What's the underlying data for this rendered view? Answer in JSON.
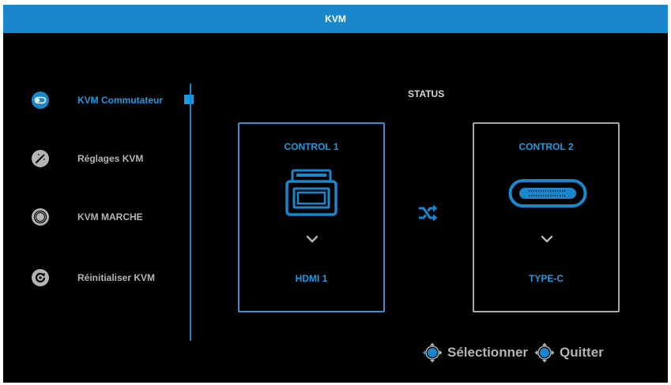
{
  "header": {
    "title": "KVM"
  },
  "menu": {
    "items": [
      {
        "label": "KVM Commutateur",
        "icon": "toggle-icon",
        "active": true
      },
      {
        "label": "Réglages KVM",
        "icon": "magic-wand-icon",
        "active": false
      },
      {
        "label": "KVM MARCHE",
        "icon": "power-ring-icon",
        "active": false
      },
      {
        "label": "Réinitialiser KVM",
        "icon": "reset-icon",
        "active": false
      }
    ]
  },
  "status": {
    "heading": "STATUS",
    "control1": {
      "title": "CONTROL 1",
      "port_icon": "hdmi-port-icon",
      "value": "HDMI 1"
    },
    "control2": {
      "title": "CONTROL 2",
      "port_icon": "usb-c-port-icon",
      "value": "TYPE-C"
    },
    "switch_icon": "shuffle-icon"
  },
  "footer": {
    "select_label": "Sélectionner",
    "exit_label": "Quitter",
    "icon": "dpad-icon"
  },
  "colors": {
    "accent": "#1a9be6",
    "titlebar": "#1a86cc",
    "text": "#b4b4b4",
    "background": "#000000"
  }
}
